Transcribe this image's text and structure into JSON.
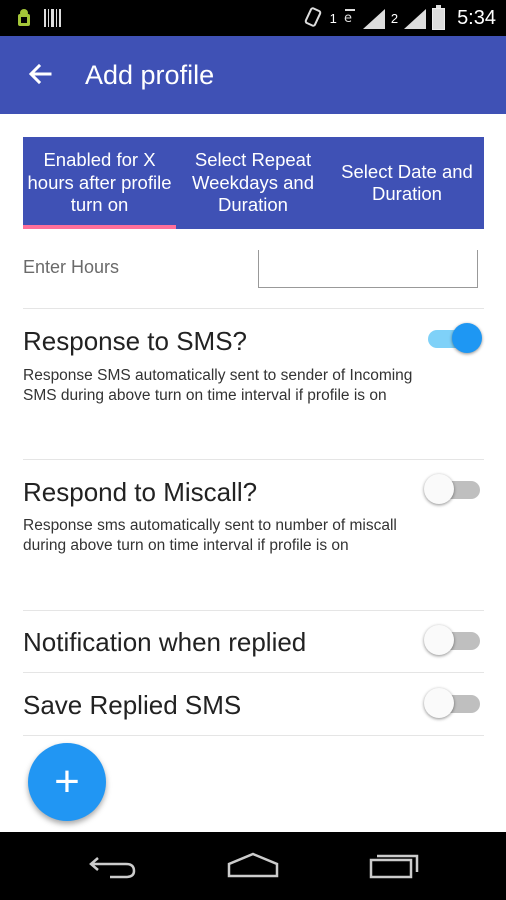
{
  "status_bar": {
    "sim1": "1",
    "sim2": "2",
    "time": "5:34"
  },
  "app_bar": {
    "title": "Add profile",
    "back_icon": "arrow-back-icon"
  },
  "tabs": [
    {
      "label": "Enabled for X hours after profile turn on",
      "selected": true
    },
    {
      "label": "Select Repeat Weekdays and Duration",
      "selected": false
    },
    {
      "label": "Select Date and Duration",
      "selected": false
    }
  ],
  "hours_field": {
    "label": "Enter Hours",
    "value": ""
  },
  "settings": {
    "response_sms": {
      "title": "Response to SMS?",
      "description": "Response SMS automatically sent to sender of Incoming SMS during above turn on time interval if profile is on",
      "enabled": true
    },
    "respond_miscall": {
      "title": "Respond to Miscall?",
      "description": "Response sms automatically sent to number of miscall during above turn on time interval if profile is on",
      "enabled": false
    },
    "notification_replied": {
      "title": "Notification when replied",
      "enabled": false
    },
    "save_replied": {
      "title": "Save Replied SMS",
      "enabled": false
    }
  },
  "fab": {
    "label": "+",
    "icon": "plus-icon"
  },
  "colors": {
    "primary": "#3F51B5",
    "accent": "#2196F3",
    "tab_indicator": "#FF6F9A"
  }
}
